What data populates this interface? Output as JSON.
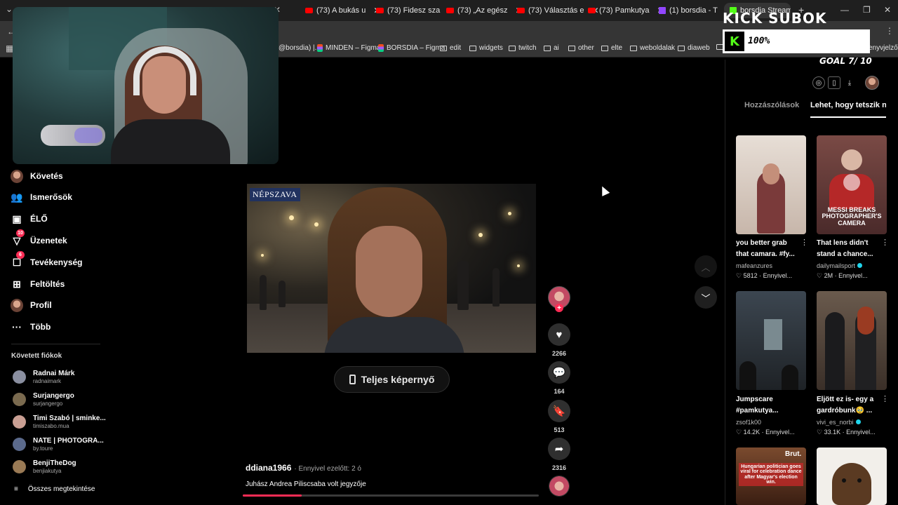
{
  "browser": {
    "tabs": [
      {
        "label": "(73) A bukás u",
        "icon": "youtube-icon"
      },
      {
        "label": "(73) Fidesz sza",
        "icon": "youtube-icon"
      },
      {
        "label": "(73) „Az egész",
        "icon": "youtube-icon"
      },
      {
        "label": "(73) Választás e",
        "icon": "youtube-icon"
      },
      {
        "label": "(73) Pamkutya",
        "icon": "youtube-icon"
      },
      {
        "label": "(1) borsdia - T",
        "icon": "twitch-icon"
      },
      {
        "label": "borsdia Stream",
        "icon": "kick-icon"
      }
    ],
    "new_tab": "+",
    "bookmarks": [
      {
        "label": "@borsdia) |...",
        "icon": "tiktok-icon"
      },
      {
        "label": "MINDEN – Figma",
        "icon": "figma-icon"
      },
      {
        "label": "BORSDIA – Figma",
        "icon": "figma-icon"
      },
      {
        "label": "edit",
        "icon": "folder-icon"
      },
      {
        "label": "widgets",
        "icon": "folder-icon"
      },
      {
        "label": "twitch",
        "icon": "folder-icon"
      },
      {
        "label": "ai",
        "icon": "folder-icon"
      },
      {
        "label": "other",
        "icon": "folder-icon"
      },
      {
        "label": "elte",
        "icon": "folder-icon"
      },
      {
        "label": "weboldalak",
        "icon": "folder-icon"
      },
      {
        "label": "diaweb",
        "icon": "folder-icon"
      }
    ],
    "bookmark_tail": "enyvjelző"
  },
  "overlay": {
    "kick_title": "KICK SUBOK",
    "kick_logo": "K",
    "kick_percent": "100%",
    "goal": "GOAL 7/ 10"
  },
  "sidebar": {
    "items": [
      {
        "label": "Követés",
        "icon": "avatar"
      },
      {
        "label": "Ismerősök",
        "icon": "friends-icon"
      },
      {
        "label": "ÉLŐ",
        "icon": "live-icon"
      },
      {
        "label": "Üzenetek",
        "icon": "messages-icon",
        "badge": "10"
      },
      {
        "label": "Tevékenység",
        "icon": "activity-icon",
        "badge": "6"
      },
      {
        "label": "Feltöltés",
        "icon": "upload-icon"
      },
      {
        "label": "Profil",
        "icon": "avatar"
      },
      {
        "label": "Több",
        "icon": "more-icon"
      }
    ],
    "following_heading": "Követett fiókok",
    "accounts": [
      {
        "name": "Radnai Márk",
        "handle": "radnaimark",
        "color": "#8a8fa0"
      },
      {
        "name": "Surjangergo",
        "handle": "surjangergo",
        "color": "#7a6a4f"
      },
      {
        "name": "Timi Szabó | sminke...",
        "handle": "timiszabo.mua",
        "color": "#c99f93"
      },
      {
        "name": "NATE | PHOTOGRA...",
        "handle": "by.toure",
        "color": "#5b6a8c"
      },
      {
        "name": "BenjiTheDog",
        "handle": "benjiakutya",
        "color": "#9a7a55"
      }
    ],
    "see_all": "Összes megtekintése"
  },
  "video": {
    "watermark": "NÉPSZAVA",
    "fullscreen_label": "Teljes képernyő",
    "author": "ddiana1966",
    "time": "· Ennyivel ezelőtt: 2 ó",
    "description": "Juhász Andrea Piliscsaba volt jegyzője",
    "progress": 0.2
  },
  "actions": {
    "likes": "2266",
    "comments": "164",
    "saves": "513",
    "shares": "2316"
  },
  "right_panel": {
    "tabs": [
      "Hozzászólások",
      "Lehet, hogy tetszik ne"
    ],
    "active_tab": 1,
    "more": "⋮",
    "videos": [
      {
        "title_1": "you better grab",
        "title_2": "that camara. #fy...",
        "user": "mafeanzures",
        "verified": false,
        "likes": "5812",
        "time": "Ennyivel...",
        "overlay": "",
        "bg": "#c9b8ad"
      },
      {
        "title_1": "That lens didn't",
        "title_2": "stand a chance...",
        "user": "dailymailsport",
        "verified": true,
        "likes": "2M",
        "time": "Ennyivel...",
        "overlay": "MESSI BREAKS PHOTOGRAPHER'S CAMERA",
        "bg": "#6e3a3a"
      },
      {
        "title_1": "Jumpscare",
        "title_2": "#pamkutya...",
        "user": "zsof1k00",
        "verified": false,
        "likes": "14.2K",
        "time": "Ennyivel...",
        "overlay": "",
        "bg": "#343c44"
      },
      {
        "title_1": "Eljött ez is- egy a",
        "title_2": "gardróbunk🥹 ...",
        "user": "vivi_es_norbi",
        "verified": true,
        "likes": "33.1K",
        "time": "Ennyivel...",
        "overlay": "",
        "bg": "#5a4a40"
      },
      {
        "title_1": "",
        "title_2": "",
        "user": "",
        "verified": false,
        "likes": "",
        "time": "",
        "overlay": "Hungarian politician goes viral for celebration dance after Magyar's election win.",
        "badge": "Brut.",
        "bg": "#4a2a1e"
      },
      {
        "title_1": "",
        "title_2": "",
        "user": "",
        "verified": false,
        "likes": "",
        "time": "",
        "overlay": "",
        "bg": "#2e2a26"
      }
    ]
  }
}
